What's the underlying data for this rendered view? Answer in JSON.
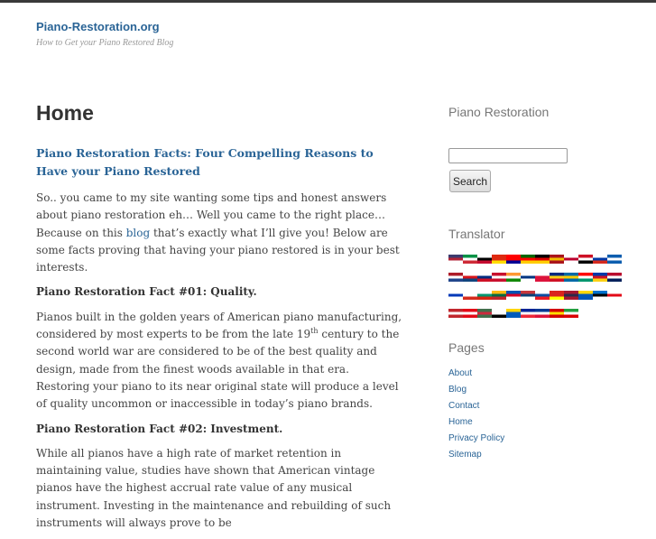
{
  "site": {
    "title": "Piano-Restoration.org",
    "tagline": "How to Get your Piano Restored Blog"
  },
  "page": {
    "heading": "Home"
  },
  "article": {
    "title": "Piano Restoration Facts: Four Compelling Reasons to Have your Piano Restored",
    "intro_before_link": "So.. you came to my site wanting some tips and honest answers about piano restoration eh… Well you came to the right place… Because on this ",
    "intro_link": "blog",
    "intro_after_link": " that’s exactly what I’ll give you! Below are some facts proving that having your piano restored is in your best interests.",
    "fact1_heading": "Piano Restoration Fact #01: Quality.",
    "fact1_before_sup": "Pianos built in the golden years of American piano manufacturing, considered by most experts to be from the late 19",
    "fact1_sup": "th",
    "fact1_after_sup": " century to the second world war are considered to be of the best quality and design, made from the finest woods available in that era. Restoring your piano to its near original state will produce a level of quality uncommon or inaccessible in today’s piano brands.",
    "fact2_heading": "Piano Restoration Fact #02: Investment.",
    "fact2_text": "While all pianos have a high rate of market retention in maintaining value, studies have shown that American vintage pianos have the highest accrual rate value of any musical instrument.  Investing in the maintenance and rebuilding of such instruments will always prove to be"
  },
  "sidebar": {
    "restoration_title": "Piano Restoration",
    "search_value": "",
    "search_button": "Search",
    "translator_title": "Translator",
    "flag_rows": [
      [
        [
          "#3c3b6e",
          "#b22234",
          "#fff"
        ],
        [
          "#009246",
          "#fff",
          "#ce2b37"
        ],
        [
          "#fff",
          "#000",
          "#c60c30"
        ],
        [
          "#de2910",
          "#de2910",
          "#ffde00"
        ],
        [
          "#fe0000",
          "#fe0000",
          "#000095"
        ],
        [
          "#006600",
          "#ff0000",
          "#ffcc00"
        ],
        [
          "#000",
          "#dd0000",
          "#ffce00"
        ],
        [
          "#aa151b",
          "#f1bf00",
          "#aa151b"
        ],
        [
          "#fff",
          "#bc002d",
          "#fff"
        ],
        [
          "#ce1126",
          "#fff",
          "#000"
        ],
        [
          "#fff",
          "#0039a6",
          "#d52b1e"
        ],
        [
          "#0d5eaf",
          "#fff",
          "#0d5eaf"
        ]
      ],
      [
        [
          "#ae1c28",
          "#fff",
          "#21468b"
        ],
        [
          "#fff",
          "#d7141a",
          "#11457e"
        ],
        [
          "#fff",
          "#002b7f",
          "#ce1126"
        ],
        [
          "#c8102e",
          "#fff",
          "#c8102e"
        ],
        [
          "#ff9933",
          "#fff",
          "#138808"
        ],
        [
          "#fff",
          "#003580",
          "#fff"
        ],
        [
          "#fff",
          "#dc143c",
          "#dc143c"
        ],
        [
          "#002b7f",
          "#fcd116",
          "#ce1126"
        ],
        [
          "#006aa7",
          "#fecc00",
          "#006aa7"
        ],
        [
          "#ff0000",
          "#fff",
          "#00966e"
        ],
        [
          "#0038a8",
          "#ce1126",
          "#fcd116"
        ],
        [
          "#ba0c2f",
          "#fff",
          "#00205b"
        ]
      ],
      [
        [
          "#fff",
          "#0038b8",
          "#fff"
        ],
        [
          "#fff",
          "#fff",
          "#d52b1e"
        ],
        [
          "#fff",
          "#00966e",
          "#d62612"
        ],
        [
          "#fdb913",
          "#006a44",
          "#c1272d"
        ],
        [
          "#0052b4",
          "#d80027",
          "#fff"
        ],
        [
          "#c6363c",
          "#0c4076",
          "#fff"
        ],
        [
          "#fff",
          "#0b4ea2",
          "#ee1c25"
        ],
        [
          "#da251d",
          "#da251d",
          "#ffff00"
        ],
        [
          "#a51931",
          "#2d2a4a",
          "#a51931"
        ],
        [
          "#ffd700",
          "#0057b7",
          "#0057b7"
        ],
        [
          "#0072ce",
          "#000",
          "#fff"
        ],
        [
          "#fff",
          "#e30a17",
          "#fff"
        ]
      ],
      [
        [
          "#c1272d",
          "#fff",
          "#c1272d"
        ],
        [
          "#e30a17",
          "#fff",
          "#e30a17"
        ],
        [
          "#436f4d",
          "#cd2a3e",
          "#436f4d"
        ],
        [
          "#fff",
          "#fff",
          "#000"
        ],
        [
          "#ffd500",
          "#005bbb",
          "#005bbb"
        ],
        [
          "#002395",
          "#fff",
          "#ed2939"
        ],
        [
          "#003893",
          "#fff",
          "#dc143c"
        ],
        [
          "#d20000",
          "#ffde00",
          "#d20000"
        ],
        [
          "#239f40",
          "#fff",
          "#da0000"
        ]
      ]
    ],
    "pages_title": "Pages",
    "pages": [
      "About",
      "Blog",
      "Contact",
      "Home",
      "Privacy Policy",
      "Sitemap"
    ]
  }
}
